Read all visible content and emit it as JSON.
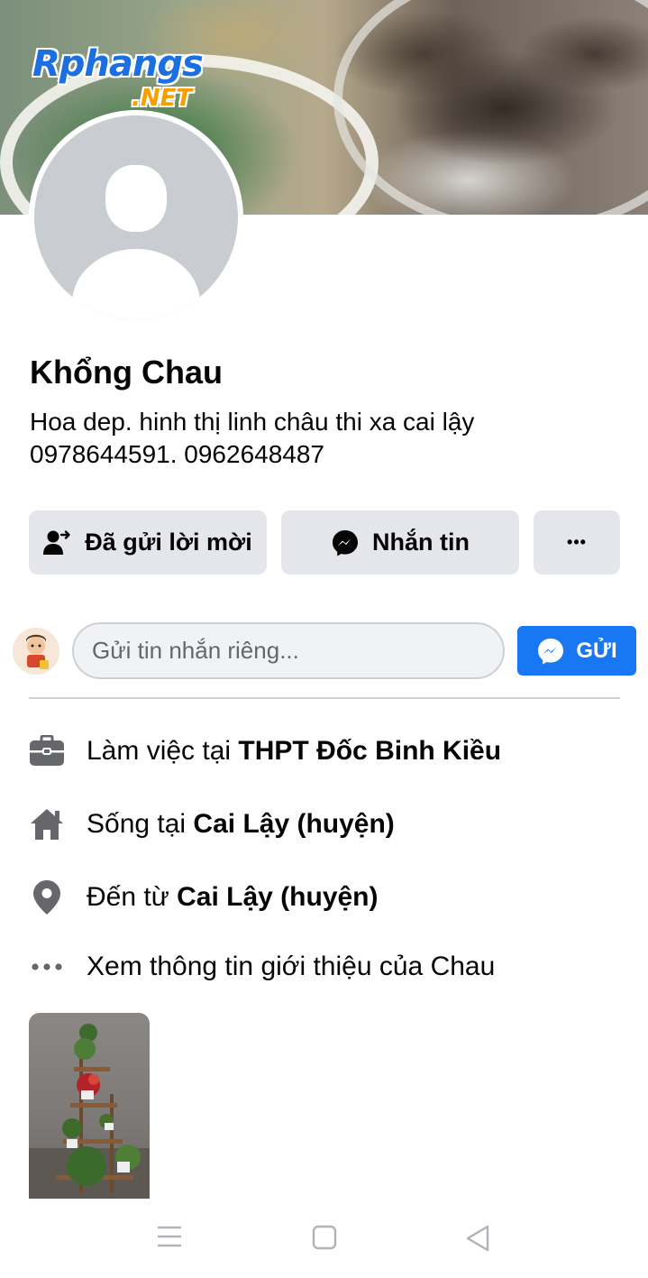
{
  "cover": {
    "watermark_main": "Rphangs",
    "watermark_suffix": ".NET"
  },
  "profile": {
    "name": "Khổng Chau",
    "bio_line1": "Hoa dep.  hinh thị linh châu thi xa cai lậy",
    "bio_line2": "0978644591.  0962648487"
  },
  "actions": {
    "request_sent_label": "Đã gửi lời mời",
    "message_label": "Nhắn tin",
    "more_label": "•••"
  },
  "private_message": {
    "placeholder": "Gửi tin nhắn riêng...",
    "send_label": "GỬI"
  },
  "intro": {
    "work_prefix": "Làm việc tại ",
    "work_place": "THPT Đốc Binh Kiều",
    "lives_prefix": "Sống tại ",
    "lives_place": "Cai Lậy (huyện)",
    "from_prefix": "Đến từ ",
    "from_place": "Cai Lậy (huyện)",
    "see_more": "Xem thông tin giới thiệu của Chau"
  },
  "colors": {
    "accent": "#1877f2",
    "button_bg": "#e4e6eb",
    "icon_gray": "#65676b"
  },
  "icons": {
    "request": "person-check-icon",
    "message": "messenger-icon",
    "more": "more-dots-icon",
    "work": "briefcase-icon",
    "lives": "home-icon",
    "from": "location-pin-icon",
    "see_more": "ellipsis-icon"
  }
}
